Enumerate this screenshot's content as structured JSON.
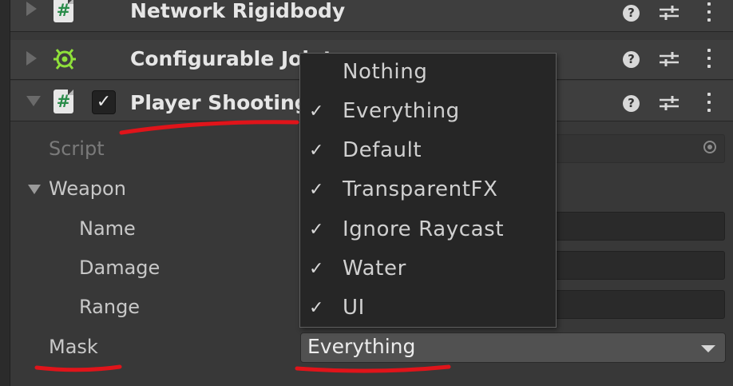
{
  "components": [
    {
      "title": "Network Rigidbody",
      "help_icon": "help-icon",
      "presets_icon": "presets-icon",
      "menu_icon": "kebab-menu-icon"
    },
    {
      "title": "Configurable Joint",
      "help_icon": "help-icon",
      "presets_icon": "presets-icon",
      "menu_icon": "kebab-menu-icon"
    },
    {
      "title": "Player Shooting",
      "enabled": true,
      "help_icon": "help-icon",
      "presets_icon": "presets-icon",
      "menu_icon": "kebab-menu-icon"
    }
  ],
  "icons": {
    "script": "#",
    "help": "?",
    "check": "✓",
    "menu_check": "✓"
  },
  "properties": {
    "script_label": "Script",
    "weapon_label": "Weapon",
    "name_label": "Name",
    "damage_label": "Damage",
    "range_label": "Range",
    "mask_label": "Mask",
    "mask_value": "Everything"
  },
  "dropdown": {
    "items": [
      {
        "label": "Nothing",
        "checked": false
      },
      {
        "label": "Everything",
        "checked": true
      },
      {
        "label": "Default",
        "checked": true
      },
      {
        "label": "TransparentFX",
        "checked": true
      },
      {
        "label": "Ignore Raycast",
        "checked": true
      },
      {
        "label": "Water",
        "checked": true
      },
      {
        "label": "UI",
        "checked": true
      }
    ]
  },
  "colors": {
    "annotation_underline": "#e0141a",
    "joint_icon": "#8fe03a",
    "script_hash": "#2a8c4a"
  }
}
